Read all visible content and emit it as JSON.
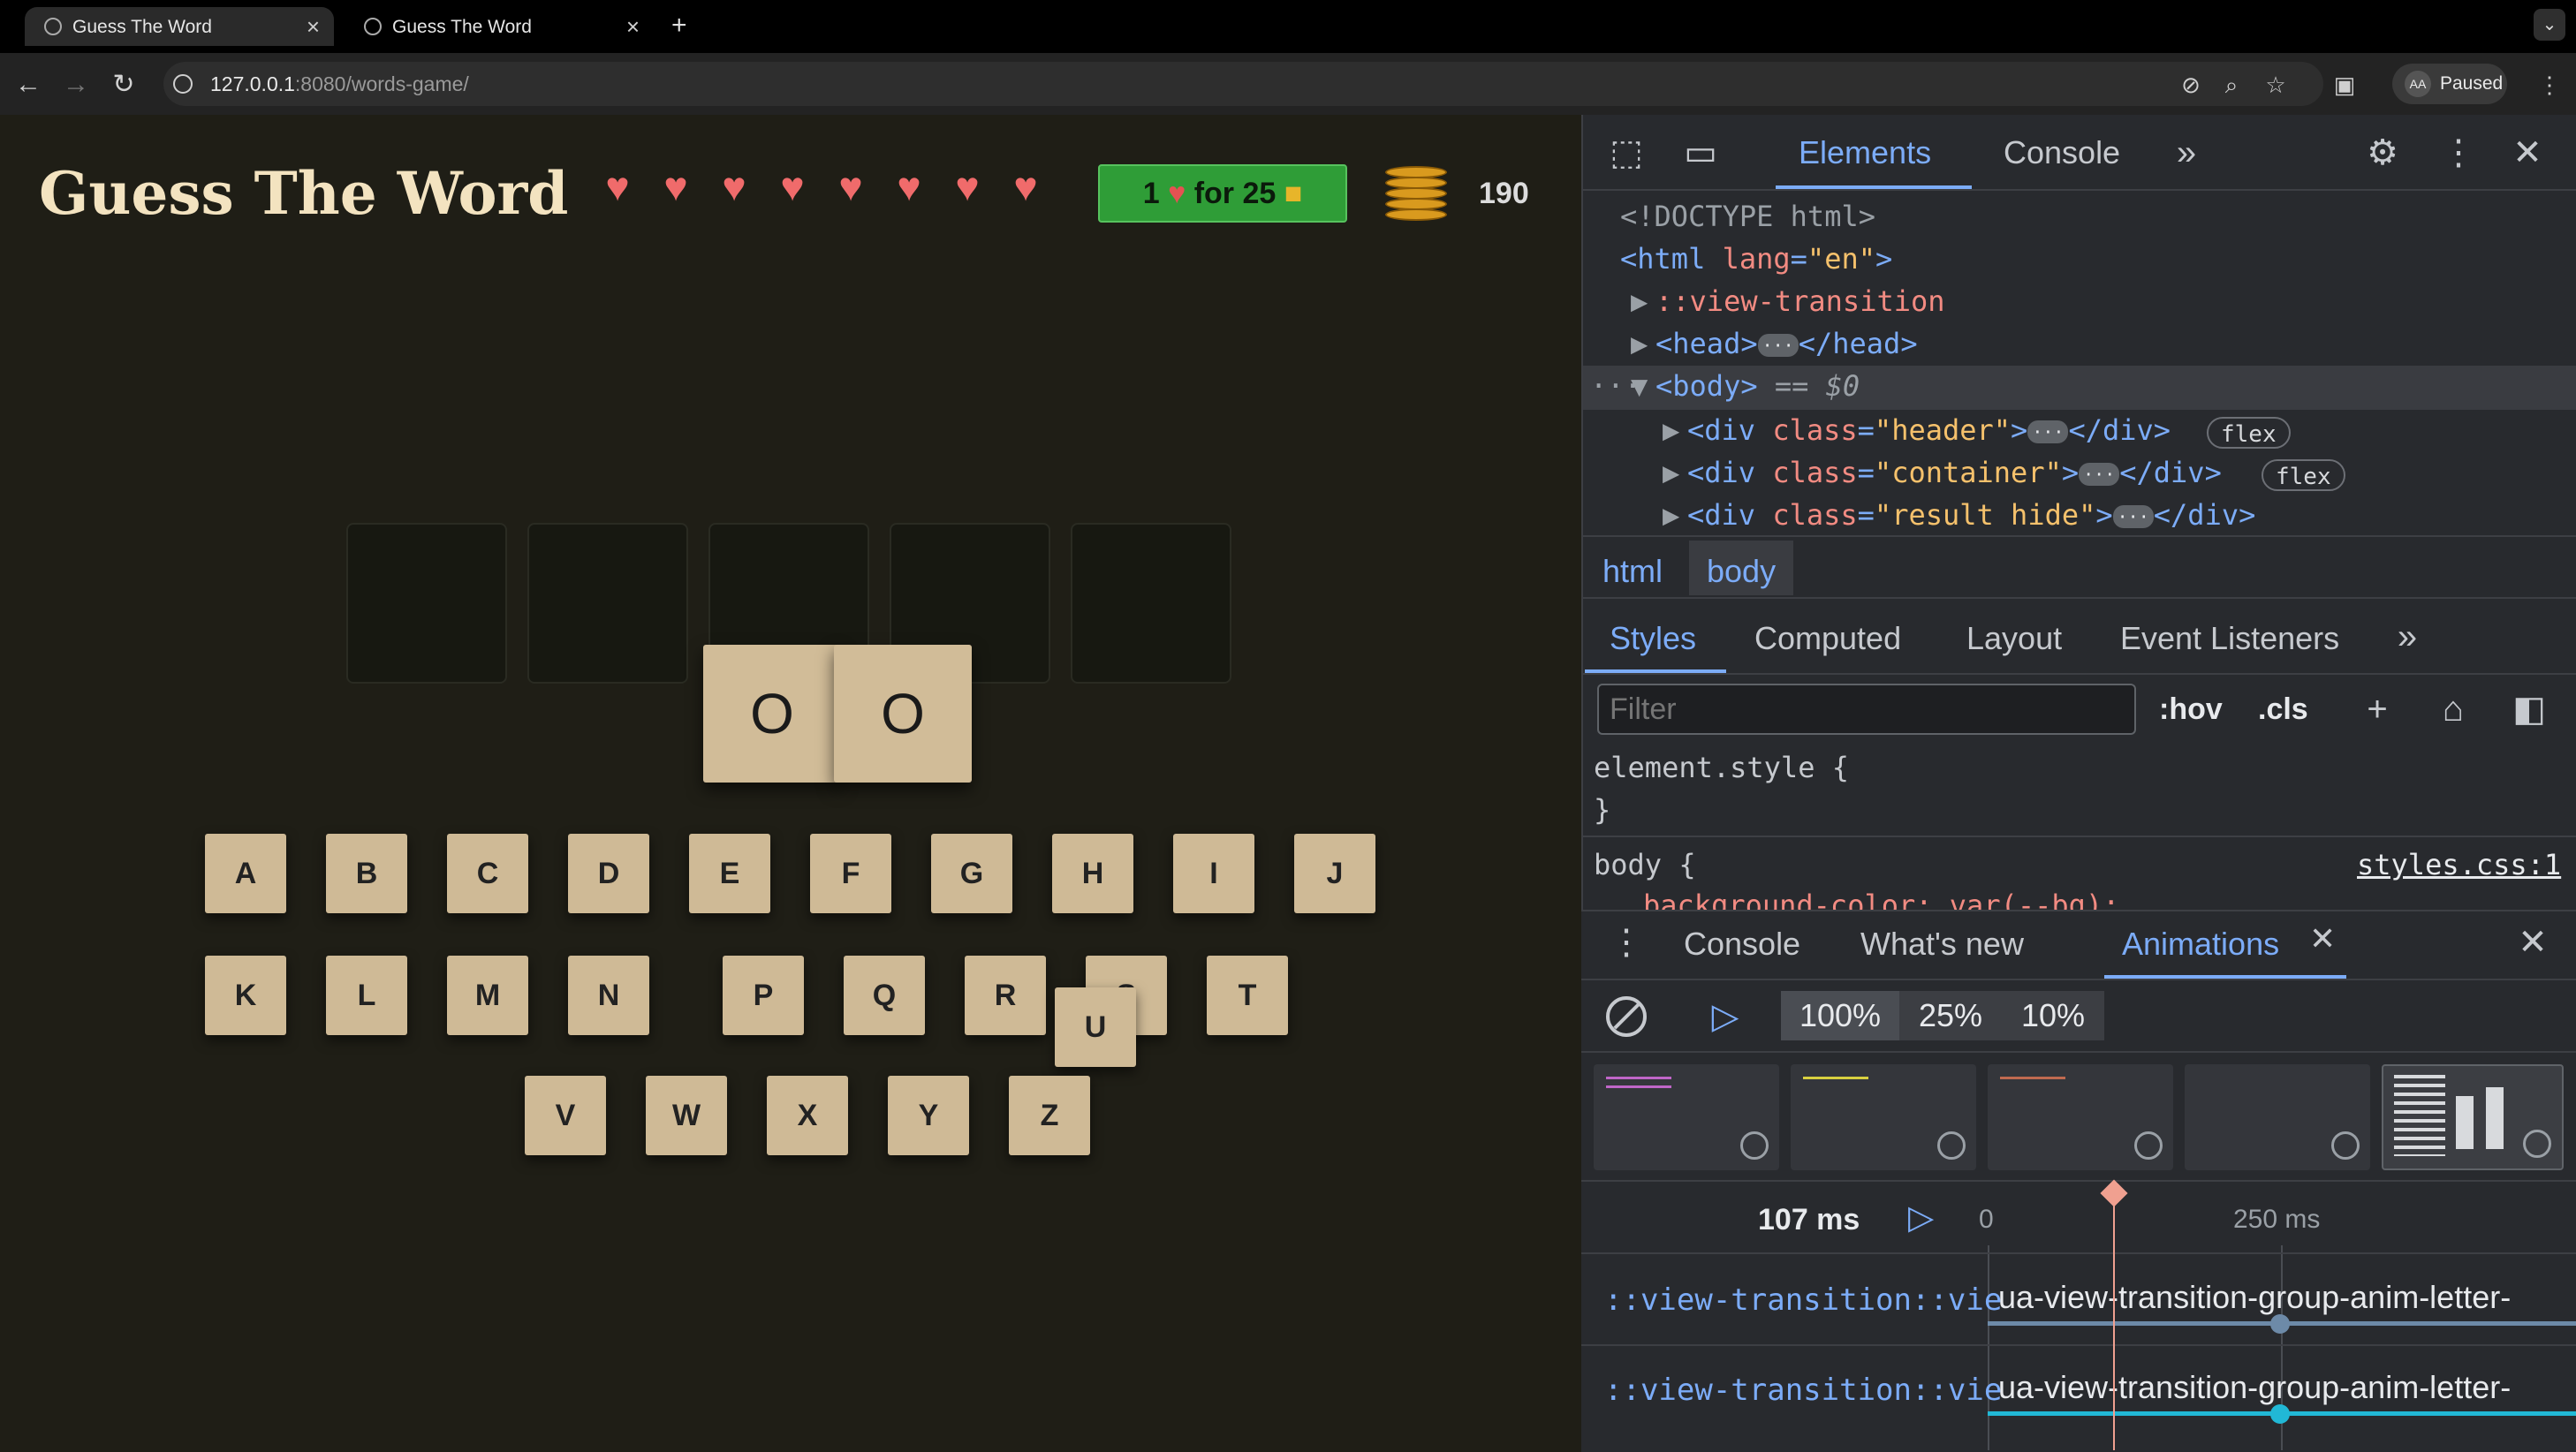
{
  "browser": {
    "tabs": [
      {
        "title": "Guess The Word",
        "active": true
      },
      {
        "title": "Guess The Word",
        "active": false
      }
    ],
    "new_tab_label": "+",
    "url_host": "127.0.0.1",
    "url_rest": ":8080/words-game/",
    "profile_label": "Paused"
  },
  "game": {
    "title": "Guess The Word",
    "hearts_count": 8,
    "buy_button": {
      "prefix": "1",
      "middle": "for 25"
    },
    "coin_count": "190",
    "slots_count": 5,
    "dragged_tiles": [
      "O",
      "O"
    ],
    "keyboard": {
      "row1": [
        "A",
        "B",
        "C",
        "D",
        "E",
        "F",
        "G",
        "H",
        "I",
        "J"
      ],
      "row2": [
        "K",
        "L",
        "M",
        "N",
        "P",
        "Q",
        "R",
        "S",
        "T"
      ],
      "row3": [
        "V",
        "W",
        "X",
        "Y",
        "Z"
      ],
      "floating_key": "U"
    }
  },
  "devtools": {
    "top_tabs": [
      "Elements",
      "Console"
    ],
    "dom_lines": {
      "doctype": "<!DOCTYPE html>",
      "html_open": "<html",
      "html_attr": "lang",
      "html_val": "\"en\"",
      "view_transition": "::view-transition",
      "head": "<head>",
      "head_close": "</head>",
      "body": "<body>",
      "body_eq": "== $0",
      "div_open": "<div",
      "class_attr": "class",
      "header_val": "\"header\"",
      "container_val": "\"container\"",
      "result_val": "\"result hide\"",
      "div_close": "</div>",
      "flex_badge": "flex",
      "ellipsis": "···"
    },
    "breadcrumbs": [
      "html",
      "body"
    ],
    "style_tabs": [
      "Styles",
      "Computed",
      "Layout",
      "Event Listeners"
    ],
    "filter_placeholder": "Filter",
    "hov_label": ":hov",
    "cls_label": ".cls",
    "element_style": "element.style {",
    "close_brace": "}",
    "body_rule": "body {",
    "stylesheet_link": "styles.css:1",
    "partial_rule": "background-color: var(--bg);",
    "drawer_tabs": [
      "Console",
      "What's new",
      "Animations"
    ],
    "speeds": [
      "100%",
      "25%",
      "10%"
    ],
    "timeline": {
      "current_time": "107 ms",
      "zero_label": "0",
      "mark_label": "250 ms"
    },
    "animation_rows": [
      {
        "selector": "::view-transition::vie",
        "name": "ua-view-transition-group-anim-letter-"
      },
      {
        "selector": "::view-transition::vie",
        "name": "ua-view-transition-group-anim-letter-"
      }
    ]
  },
  "colors": {
    "heart": "#f06b6b",
    "buy_button": "#2f9d37",
    "tile": "#cfba96",
    "devtools_accent": "#7cacf8"
  }
}
